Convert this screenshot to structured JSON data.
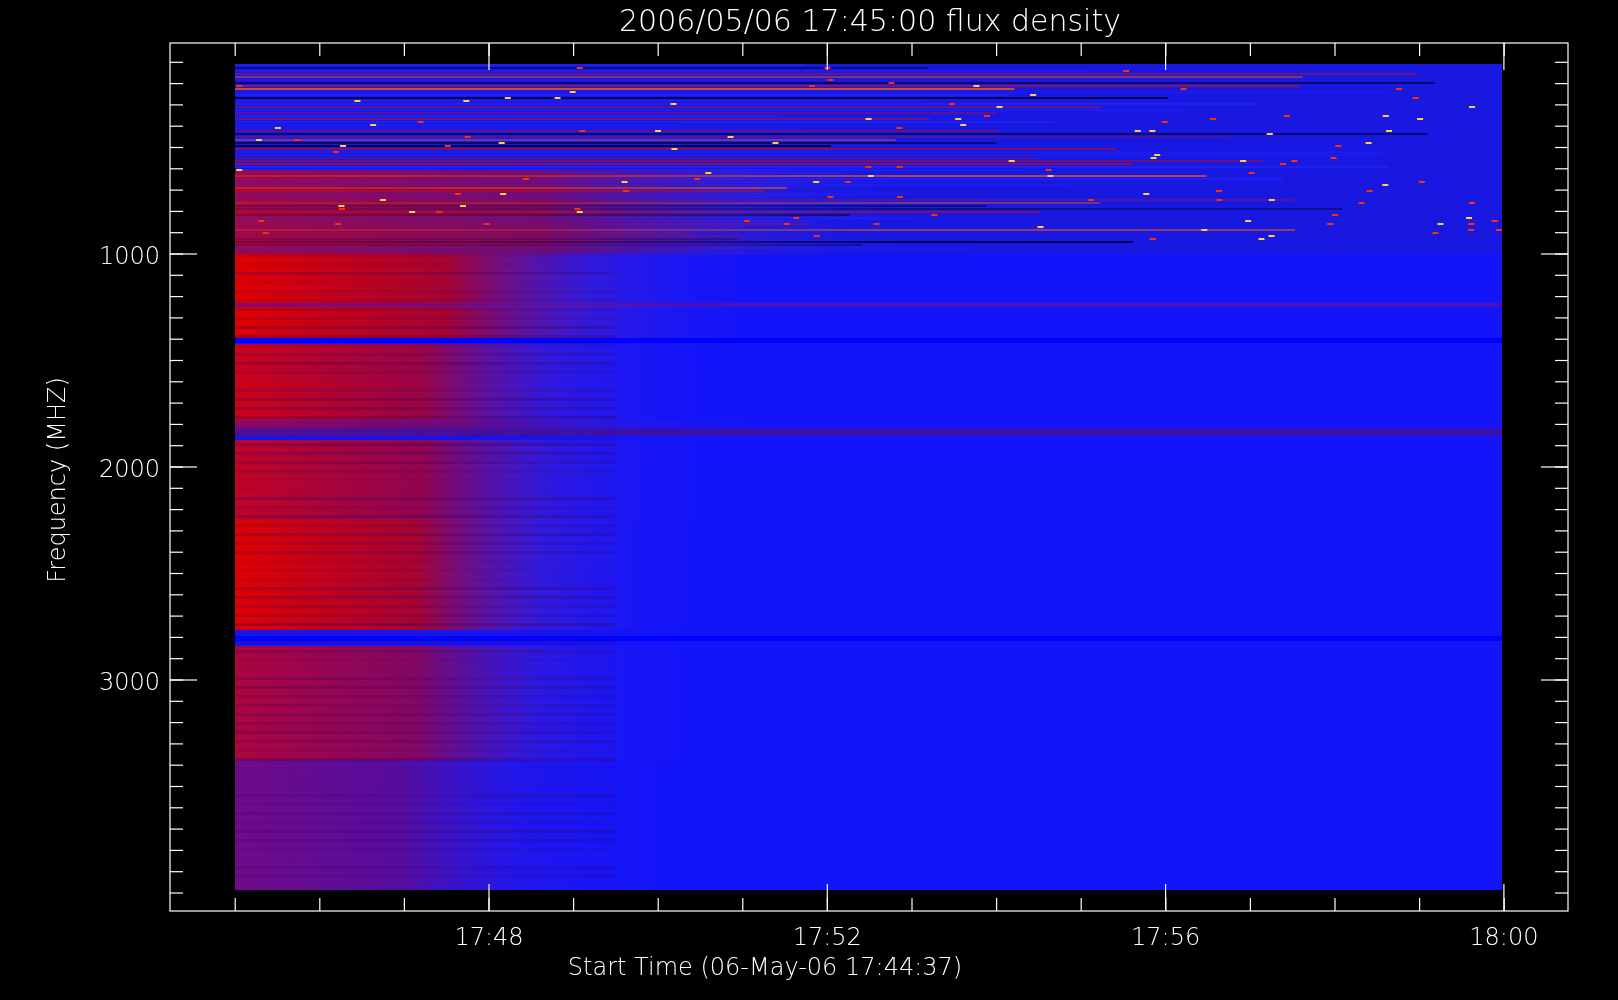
{
  "title": "2006/05/06 17:45:00 flux density",
  "y_axis": {
    "label": "Frequency (MHZ)",
    "ticks": [
      "1000",
      "2000",
      "3000"
    ]
  },
  "x_axis": {
    "label": "Start Time (06-May-06 17:44:37)",
    "ticks": [
      "17:48",
      "17:52",
      "17:56",
      "18:00"
    ]
  }
}
